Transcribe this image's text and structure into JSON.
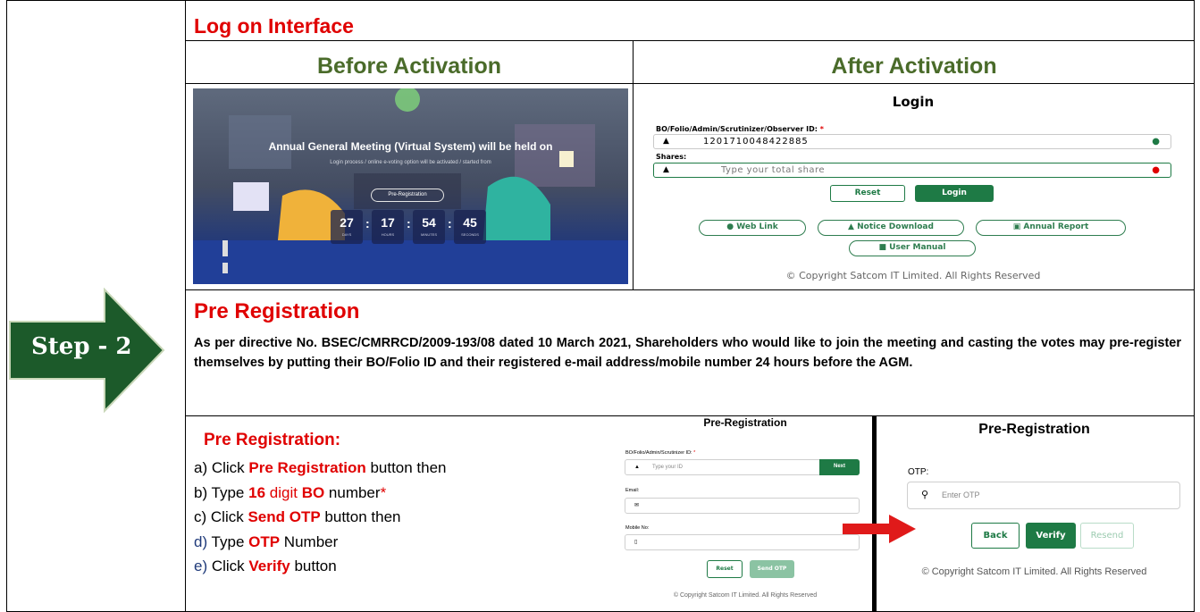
{
  "header": {
    "title": "Log on Interface",
    "before_label": "Before Activation",
    "after_label": "After Activation"
  },
  "step": {
    "label": "Step - 2"
  },
  "before_screen": {
    "headline": "Annual General Meeting (Virtual System) will be held on",
    "subtext": "Login process / online e-voting option will be activated / started from",
    "pre_reg_button": "Pre-Registration",
    "countdown": [
      {
        "value": "27",
        "unit": "DAYS"
      },
      {
        "value": "17",
        "unit": "HOURS"
      },
      {
        "value": "54",
        "unit": "MINUTES"
      },
      {
        "value": "45",
        "unit": "SECONDS"
      }
    ]
  },
  "after_screen": {
    "title": "Login",
    "id_label": "BO/Folio/Admin/Scrutinizer/Observer ID:",
    "id_required": "*",
    "id_value": "1201710048422885",
    "shares_label": "Shares:",
    "shares_placeholder": "Type your total share",
    "reset_button": "Reset",
    "login_button": "Login",
    "links": {
      "web_link": "Web Link",
      "notice_download": "Notice Download",
      "annual_report": "Annual Report",
      "user_manual": "User Manual"
    },
    "copyright": "© Copyright Satcom IT Limited. All Rights Reserved"
  },
  "pre_registration": {
    "title": "Pre Registration",
    "paragraph": "As per directive No. BSEC/CMRRCD/2009-193/08 dated 10 March 2021, Shareholders who would like to join the meeting and casting the votes may pre-register themselves by putting their BO/Folio ID and their registered e-mail address/mobile number 24 hours before the AGM.",
    "steps_heading": "Pre Registration:",
    "steps": {
      "a_prefix": "a) Click ",
      "a_em": "Pre Registration",
      "a_suffix": " button then",
      "b_prefix": "b) Type ",
      "b_em1": "16",
      "b_mid": " digit ",
      "b_em2": "BO",
      "b_suffix": " number",
      "b_star": "*",
      "c_prefix": "c) Click ",
      "c_em": "Send OTP",
      "c_suffix": " button then",
      "d_letter": "d)",
      "d_prefix": " Type ",
      "d_em": "OTP",
      "d_suffix": " Number",
      "e_letter": "e)",
      "e_prefix": " Click ",
      "e_em": "Verify",
      "e_suffix": " button"
    }
  },
  "pre_form": {
    "title": "Pre-Registration",
    "id_label": "BO/Folio/Admin/Scrutinizer ID:",
    "id_required": "*",
    "id_placeholder": "Type your ID",
    "next_button": "Next",
    "email_label": "Email:",
    "mobile_label": "Mobile No:",
    "reset_button": "Reset",
    "send_otp_button": "Send OTP",
    "copyright": "© Copyright Satcom IT Limited. All Rights Reserved"
  },
  "otp_form": {
    "title": "Pre-Registration",
    "otp_label": "OTP:",
    "otp_placeholder": "Enter OTP",
    "back_button": "Back",
    "verify_button": "Verify",
    "resend_button": "Resend",
    "copyright": "© Copyright Satcom IT Limited. All Rights Reserved"
  },
  "colors": {
    "red": "#e00000",
    "heading_green": "#4a6b2a",
    "button_green": "#1e7a45",
    "arrow_green": "#1c5a2a"
  }
}
